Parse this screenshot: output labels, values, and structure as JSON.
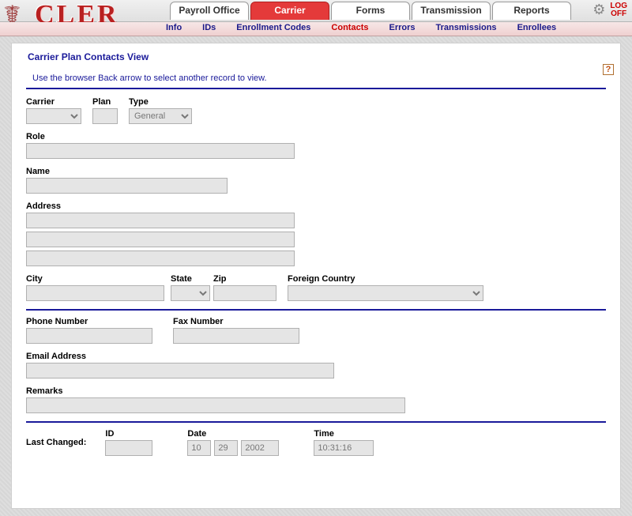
{
  "app": {
    "logo_text": "CLER"
  },
  "tabs": {
    "items": [
      {
        "label": "Payroll Office"
      },
      {
        "label": "Carrier",
        "active": true
      },
      {
        "label": "Forms"
      },
      {
        "label": "Transmission"
      },
      {
        "label": "Reports"
      }
    ],
    "logoff_line1": "LOG",
    "logoff_line2": "OFF"
  },
  "subnav": {
    "items": [
      {
        "label": "Info"
      },
      {
        "label": "IDs"
      },
      {
        "label": "Enrollment Codes"
      },
      {
        "label": "Contacts",
        "active": true
      },
      {
        "label": "Errors"
      },
      {
        "label": "Transmissions"
      },
      {
        "label": "Enrollees"
      }
    ]
  },
  "page": {
    "title": "Carrier Plan Contacts View",
    "instruction": "Use the browser Back arrow to select another record to view.",
    "help": "?"
  },
  "labels": {
    "carrier": "Carrier",
    "plan": "Plan",
    "type": "Type",
    "role": "Role",
    "name": "Name",
    "address": "Address",
    "city": "City",
    "state": "State",
    "zip": "Zip",
    "foreign_country": "Foreign Country",
    "phone": "Phone Number",
    "fax": "Fax Number",
    "email": "Email Address",
    "remarks": "Remarks",
    "last_changed": "Last Changed:",
    "id": "ID",
    "date": "Date",
    "time": "Time"
  },
  "values": {
    "carrier": "",
    "plan": "",
    "type": "General",
    "role": "",
    "name": "",
    "address1": "",
    "address2": "",
    "address3": "",
    "city": "",
    "state": "",
    "zip": "",
    "foreign_country": "",
    "phone": "",
    "fax": "",
    "email": "",
    "remarks": "",
    "last_changed": {
      "id": "",
      "date_mm": "10",
      "date_dd": "29",
      "date_yyyy": "2002",
      "time": "10:31:16"
    }
  }
}
